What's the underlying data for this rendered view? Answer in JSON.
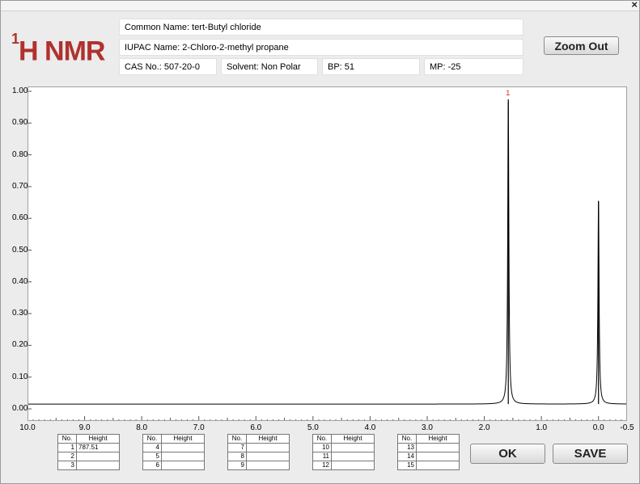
{
  "window": {
    "close_glyph": "×"
  },
  "logo": {
    "sup": "1",
    "text": "H NMR"
  },
  "info": {
    "common_name": "Common Name:  tert-Butyl chloride",
    "iupac_name": "IUPAC Name:  2-Chloro-2-methyl propane",
    "cas": "CAS No.: 507-20-0",
    "solvent": "Solvent: Non Polar",
    "bp": "BP: 51",
    "mp": "MP: -25"
  },
  "buttons": {
    "zoom_out": "Zoom Out",
    "ok": "OK",
    "save": "SAVE"
  },
  "chart_data": {
    "type": "line",
    "title": "",
    "xlabel": "",
    "ylabel": "",
    "xlim": [
      10.0,
      -0.5
    ],
    "ylim": [
      0,
      1.0
    ],
    "x_ticks": [
      "10.0",
      "9.0",
      "8.0",
      "7.0",
      "6.0",
      "5.0",
      "4.0",
      "3.0",
      "2.0",
      "1.0",
      "0.0",
      "-0.5"
    ],
    "y_ticks": [
      "1.00",
      "0.90",
      "0.80",
      "0.70",
      "0.60",
      "0.50",
      "0.40",
      "0.30",
      "0.20",
      "0.10",
      "0.00"
    ],
    "peaks": [
      {
        "label": "1",
        "ppm": 1.58,
        "intensity": 0.96
      },
      {
        "label": "",
        "ppm": 0.0,
        "intensity": 0.64
      }
    ],
    "baseline": 0.015
  },
  "peak_tables": [
    {
      "header_no": "No.",
      "header_height": "Height",
      "rows": [
        [
          "1",
          "787.51"
        ],
        [
          "2",
          ""
        ],
        [
          "3",
          ""
        ]
      ]
    },
    {
      "header_no": "No.",
      "header_height": "Height",
      "rows": [
        [
          "4",
          ""
        ],
        [
          "5",
          ""
        ],
        [
          "6",
          ""
        ]
      ]
    },
    {
      "header_no": "No.",
      "header_height": "Height",
      "rows": [
        [
          "7",
          ""
        ],
        [
          "8",
          ""
        ],
        [
          "9",
          ""
        ]
      ]
    },
    {
      "header_no": "No.",
      "header_height": "Height",
      "rows": [
        [
          "10",
          ""
        ],
        [
          "11",
          ""
        ],
        [
          "12",
          ""
        ]
      ]
    },
    {
      "header_no": "No.",
      "header_height": "Height",
      "rows": [
        [
          "13",
          ""
        ],
        [
          "14",
          ""
        ],
        [
          "15",
          ""
        ]
      ]
    }
  ]
}
